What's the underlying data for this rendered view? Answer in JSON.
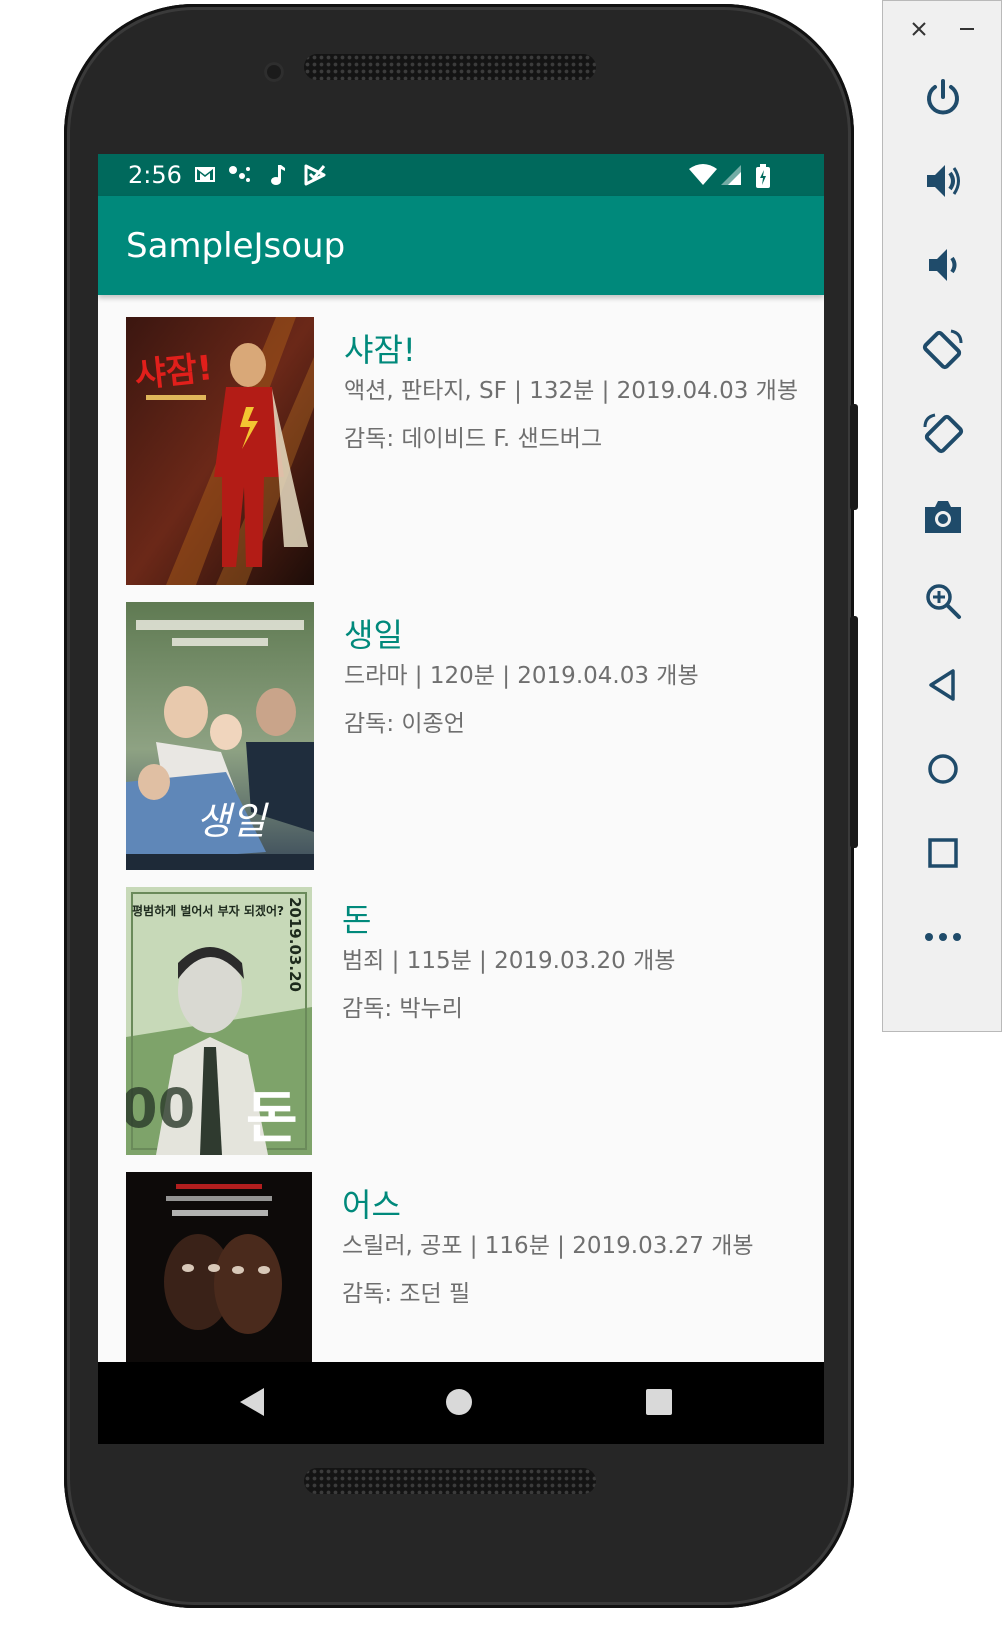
{
  "status_bar": {
    "time": "2:56"
  },
  "app_bar": {
    "title": "SampleJsoup"
  },
  "movies": [
    {
      "title": "샤잠!",
      "info": "액션, 판타지, SF | 132분 | 2019.04.03 개봉",
      "director": "감독: 데이비드 F. 샌드버그"
    },
    {
      "title": "생일",
      "info": "드라마 | 120분 | 2019.04.03 개봉",
      "director": "감독: 이종언"
    },
    {
      "title": "돈",
      "info": "범죄 | 115분 | 2019.03.20 개봉",
      "director": "감독: 박누리"
    },
    {
      "title": "어스",
      "info": "스릴러, 공포 | 116분 | 2019.03.27 개봉",
      "director": "감독: 조던 필"
    }
  ],
  "posters": {
    "shazam_text": "샤잠!",
    "birthday_text": "생일",
    "money_title": "돈",
    "money_date": "2019.03.20",
    "money_tagline": "평범하게 벌어서 부자 되겠어?"
  },
  "nav_bar": {
    "back": "back-icon",
    "home": "home-icon",
    "recents": "recents-icon"
  },
  "emulator_toolbar": {
    "buttons": [
      "power",
      "volume-up",
      "volume-down",
      "rotate-left",
      "rotate-right",
      "screenshot",
      "zoom",
      "back",
      "home",
      "overview",
      "more"
    ]
  },
  "colors": {
    "status_bar": "#00695c",
    "app_bar": "#00897b",
    "title_text": "#00897b",
    "body_text": "#6f6f6f"
  }
}
